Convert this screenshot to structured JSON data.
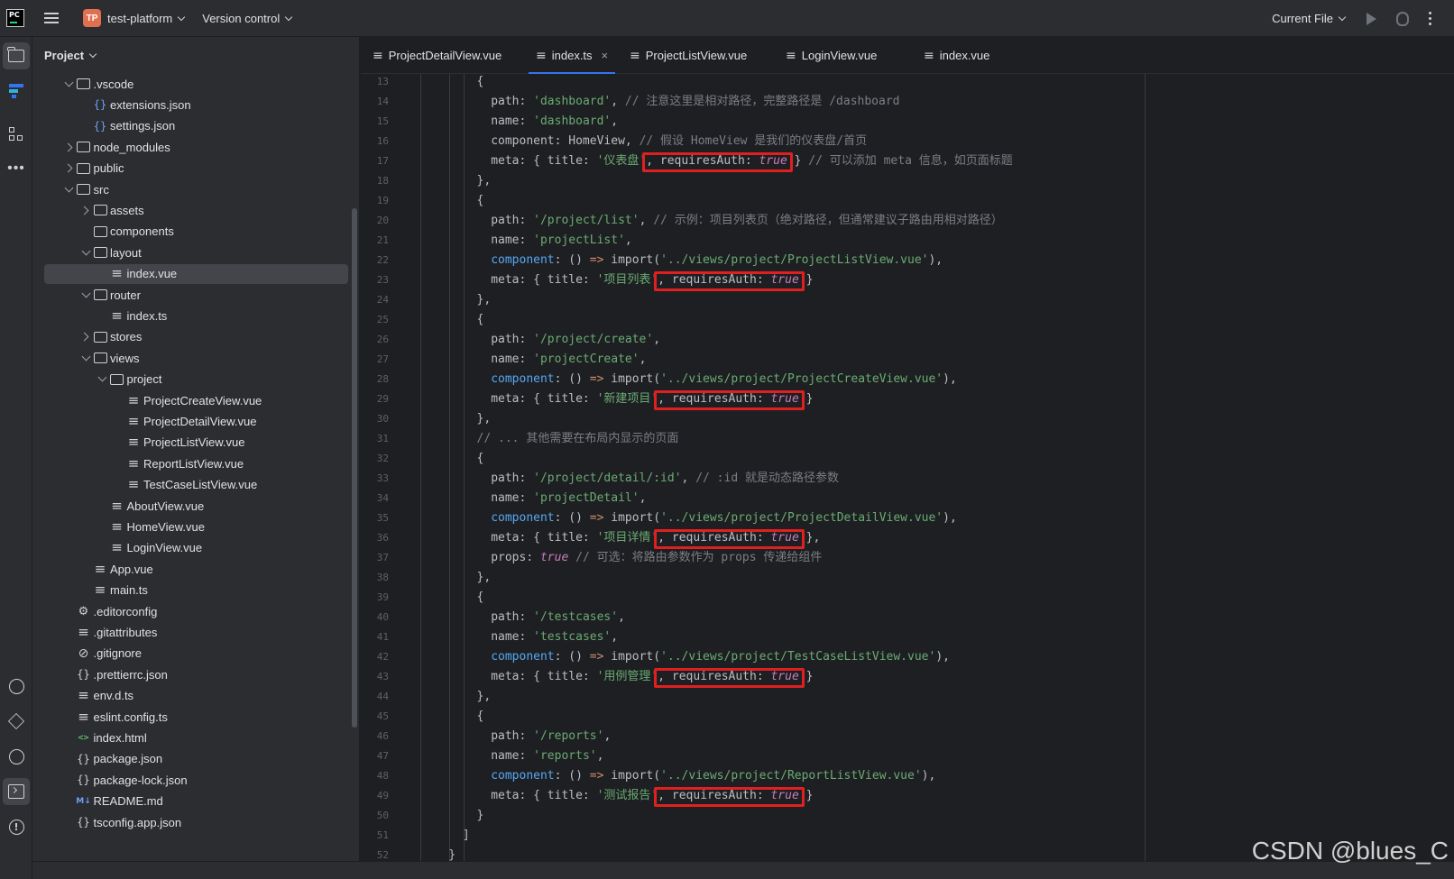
{
  "titlebar": {
    "project_badge": "TP",
    "project_name": "test-platform",
    "vcs": "Version control",
    "run_config": "Current File"
  },
  "project_panel": {
    "title": "Project",
    "tree": [
      {
        "label": ".vscode",
        "depth": 2,
        "arrow": "open",
        "icon": "folder"
      },
      {
        "label": "extensions.json",
        "depth": 3,
        "arrow": "none",
        "icon": "json-blue"
      },
      {
        "label": "settings.json",
        "depth": 3,
        "arrow": "none",
        "icon": "json-blue"
      },
      {
        "label": "node_modules",
        "depth": 2,
        "arrow": "closed",
        "icon": "folder"
      },
      {
        "label": "public",
        "depth": 2,
        "arrow": "closed",
        "icon": "folder"
      },
      {
        "label": "src",
        "depth": 2,
        "arrow": "open",
        "icon": "folder"
      },
      {
        "label": "assets",
        "depth": 3,
        "arrow": "closed",
        "icon": "folder"
      },
      {
        "label": "components",
        "depth": 3,
        "arrow": "none",
        "icon": "folder"
      },
      {
        "label": "layout",
        "depth": 3,
        "arrow": "open",
        "icon": "folder"
      },
      {
        "label": "index.vue",
        "depth": 4,
        "arrow": "none",
        "icon": "lines",
        "selected": true
      },
      {
        "label": "router",
        "depth": 3,
        "arrow": "open",
        "icon": "folder"
      },
      {
        "label": "index.ts",
        "depth": 4,
        "arrow": "none",
        "icon": "lines"
      },
      {
        "label": "stores",
        "depth": 3,
        "arrow": "closed",
        "icon": "folder"
      },
      {
        "label": "views",
        "depth": 3,
        "arrow": "open",
        "icon": "folder"
      },
      {
        "label": "project",
        "depth": 4,
        "arrow": "open",
        "icon": "folder"
      },
      {
        "label": "ProjectCreateView.vue",
        "depth": 5,
        "arrow": "none",
        "icon": "lines"
      },
      {
        "label": "ProjectDetailView.vue",
        "depth": 5,
        "arrow": "none",
        "icon": "lines"
      },
      {
        "label": "ProjectListView.vue",
        "depth": 5,
        "arrow": "none",
        "icon": "lines"
      },
      {
        "label": "ReportListView.vue",
        "depth": 5,
        "arrow": "none",
        "icon": "lines"
      },
      {
        "label": "TestCaseListView.vue",
        "depth": 5,
        "arrow": "none",
        "icon": "lines"
      },
      {
        "label": "AboutView.vue",
        "depth": 4,
        "arrow": "none",
        "icon": "lines"
      },
      {
        "label": "HomeView.vue",
        "depth": 4,
        "arrow": "none",
        "icon": "lines"
      },
      {
        "label": "LoginView.vue",
        "depth": 4,
        "arrow": "none",
        "icon": "lines"
      },
      {
        "label": "App.vue",
        "depth": 3,
        "arrow": "none",
        "icon": "lines"
      },
      {
        "label": "main.ts",
        "depth": 3,
        "arrow": "none",
        "icon": "lines"
      },
      {
        "label": ".editorconfig",
        "depth": 2,
        "arrow": "none",
        "icon": "gear"
      },
      {
        "label": ".gitattributes",
        "depth": 2,
        "arrow": "none",
        "icon": "lines"
      },
      {
        "label": ".gitignore",
        "depth": 2,
        "arrow": "none",
        "icon": "ban"
      },
      {
        "label": ".prettierrc.json",
        "depth": 2,
        "arrow": "none",
        "icon": "json"
      },
      {
        "label": "env.d.ts",
        "depth": 2,
        "arrow": "none",
        "icon": "lines"
      },
      {
        "label": "eslint.config.ts",
        "depth": 2,
        "arrow": "none",
        "icon": "lines"
      },
      {
        "label": "index.html",
        "depth": 2,
        "arrow": "none",
        "icon": "html"
      },
      {
        "label": "package.json",
        "depth": 2,
        "arrow": "none",
        "icon": "json"
      },
      {
        "label": "package-lock.json",
        "depth": 2,
        "arrow": "none",
        "icon": "json"
      },
      {
        "label": "README.md",
        "depth": 2,
        "arrow": "none",
        "icon": "md"
      },
      {
        "label": "tsconfig.app.json",
        "depth": 2,
        "arrow": "none",
        "icon": "json"
      }
    ]
  },
  "tabs": [
    {
      "label": "ProjectDetailView.vue",
      "active": false
    },
    {
      "label": "index.ts",
      "active": true,
      "closable": true
    },
    {
      "label": "ProjectListView.vue",
      "active": false
    },
    {
      "label": "LoginView.vue",
      "active": false
    },
    {
      "label": "index.vue",
      "active": false
    }
  ],
  "tab_close": "×",
  "editor": {
    "first_line": 13,
    "lines": [
      {
        "n": 13,
        "ind": 8,
        "parts": [
          [
            "k",
            "{"
          ]
        ]
      },
      {
        "n": 14,
        "ind": 10,
        "parts": [
          [
            "k",
            "path: "
          ],
          [
            "s",
            "'dashboard'"
          ],
          [
            "k",
            ", "
          ],
          [
            "c",
            "// 注意这里是相对路径，完整路径是 /dashboard"
          ]
        ]
      },
      {
        "n": 15,
        "ind": 10,
        "parts": [
          [
            "k",
            "name: "
          ],
          [
            "s",
            "'dashboard'"
          ],
          [
            "k",
            ","
          ]
        ]
      },
      {
        "n": 16,
        "ind": 10,
        "parts": [
          [
            "k",
            "component: HomeView, "
          ],
          [
            "c",
            "// 假设 HomeView 是我们的仪表盘/首页"
          ]
        ]
      },
      {
        "n": 17,
        "ind": 10,
        "parts": [
          [
            "k",
            "meta: { title: "
          ],
          [
            "s",
            "'仪表盘'"
          ],
          [
            "k",
            ", requiresAuth: "
          ],
          [
            "it",
            "true"
          ],
          [
            "k",
            " } "
          ],
          [
            "c",
            "// 可以添加 meta 信息，如页面标题"
          ]
        ]
      },
      {
        "n": 18,
        "ind": 8,
        "parts": [
          [
            "k",
            "},"
          ]
        ]
      },
      {
        "n": 19,
        "ind": 8,
        "parts": [
          [
            "k",
            "{"
          ]
        ]
      },
      {
        "n": 20,
        "ind": 10,
        "parts": [
          [
            "k",
            "path: "
          ],
          [
            "s",
            "'/project/list'"
          ],
          [
            "k",
            ", "
          ],
          [
            "c",
            "// 示例：项目列表页（绝对路径，但通常建议子路由用相对路径）"
          ]
        ]
      },
      {
        "n": 21,
        "ind": 10,
        "parts": [
          [
            "k",
            "name: "
          ],
          [
            "s",
            "'projectList'"
          ],
          [
            "k",
            ","
          ]
        ]
      },
      {
        "n": 22,
        "ind": 10,
        "parts": [
          [
            "f",
            "component"
          ],
          [
            "k",
            ": () "
          ],
          [
            "kw",
            "=>"
          ],
          [
            "k",
            " import("
          ],
          [
            "s",
            "'../views/project/ProjectListView.vue'"
          ],
          [
            "k",
            "),"
          ]
        ]
      },
      {
        "n": 23,
        "ind": 10,
        "parts": [
          [
            "k",
            "meta: { title: "
          ],
          [
            "s",
            "'项目列表'"
          ],
          [
            "k",
            ", requiresAuth: "
          ],
          [
            "it",
            "true"
          ],
          [
            "k",
            " }"
          ]
        ]
      },
      {
        "n": 24,
        "ind": 8,
        "parts": [
          [
            "k",
            "},"
          ]
        ]
      },
      {
        "n": 25,
        "ind": 8,
        "parts": [
          [
            "k",
            "{"
          ]
        ]
      },
      {
        "n": 26,
        "ind": 10,
        "parts": [
          [
            "k",
            "path: "
          ],
          [
            "s",
            "'/project/create'"
          ],
          [
            "k",
            ","
          ]
        ]
      },
      {
        "n": 27,
        "ind": 10,
        "parts": [
          [
            "k",
            "name: "
          ],
          [
            "s",
            "'projectCreate'"
          ],
          [
            "k",
            ","
          ]
        ]
      },
      {
        "n": 28,
        "ind": 10,
        "parts": [
          [
            "f",
            "component"
          ],
          [
            "k",
            ": () "
          ],
          [
            "kw",
            "=>"
          ],
          [
            "k",
            " import("
          ],
          [
            "s",
            "'../views/project/ProjectCreateView.vue'"
          ],
          [
            "k",
            "),"
          ]
        ]
      },
      {
        "n": 29,
        "ind": 10,
        "parts": [
          [
            "k",
            "meta: { title: "
          ],
          [
            "s",
            "'新建项目'"
          ],
          [
            "k",
            ", requiresAuth: "
          ],
          [
            "it",
            "true"
          ],
          [
            "k",
            " }"
          ]
        ]
      },
      {
        "n": 30,
        "ind": 8,
        "parts": [
          [
            "k",
            "},"
          ]
        ]
      },
      {
        "n": 31,
        "ind": 8,
        "parts": [
          [
            "c",
            "// ... 其他需要在布局内显示的页面"
          ]
        ]
      },
      {
        "n": 32,
        "ind": 8,
        "parts": [
          [
            "k",
            "{"
          ]
        ]
      },
      {
        "n": 33,
        "ind": 10,
        "parts": [
          [
            "k",
            "path: "
          ],
          [
            "s",
            "'/project/detail/:id'"
          ],
          [
            "k",
            ", "
          ],
          [
            "c",
            "// :id 就是动态路径参数"
          ]
        ]
      },
      {
        "n": 34,
        "ind": 10,
        "parts": [
          [
            "k",
            "name: "
          ],
          [
            "s",
            "'projectDetail'"
          ],
          [
            "k",
            ","
          ]
        ]
      },
      {
        "n": 35,
        "ind": 10,
        "parts": [
          [
            "f",
            "component"
          ],
          [
            "k",
            ": () "
          ],
          [
            "kw",
            "=>"
          ],
          [
            "k",
            " import("
          ],
          [
            "s",
            "'../views/project/ProjectDetailView.vue'"
          ],
          [
            "k",
            "),"
          ]
        ]
      },
      {
        "n": 36,
        "ind": 10,
        "parts": [
          [
            "k",
            "meta: { title: "
          ],
          [
            "s",
            "'项目详情'"
          ],
          [
            "k",
            ", requiresAuth: "
          ],
          [
            "it",
            "true"
          ],
          [
            "k",
            " },"
          ]
        ]
      },
      {
        "n": 37,
        "ind": 10,
        "parts": [
          [
            "k",
            "props: "
          ],
          [
            "it",
            "true"
          ],
          [
            "k",
            " "
          ],
          [
            "c",
            "// 可选：将路由参数作为 props 传递给组件"
          ]
        ]
      },
      {
        "n": 38,
        "ind": 8,
        "parts": [
          [
            "k",
            "},"
          ]
        ]
      },
      {
        "n": 39,
        "ind": 8,
        "parts": [
          [
            "k",
            "{"
          ]
        ]
      },
      {
        "n": 40,
        "ind": 10,
        "parts": [
          [
            "k",
            "path: "
          ],
          [
            "s",
            "'/testcases'"
          ],
          [
            "k",
            ","
          ]
        ]
      },
      {
        "n": 41,
        "ind": 10,
        "parts": [
          [
            "k",
            "name: "
          ],
          [
            "s",
            "'testcases'"
          ],
          [
            "k",
            ","
          ]
        ]
      },
      {
        "n": 42,
        "ind": 10,
        "parts": [
          [
            "f",
            "component"
          ],
          [
            "k",
            ": () "
          ],
          [
            "kw",
            "=>"
          ],
          [
            "k",
            " import("
          ],
          [
            "s",
            "'../views/project/TestCaseListView.vue'"
          ],
          [
            "k",
            "),"
          ]
        ]
      },
      {
        "n": 43,
        "ind": 10,
        "parts": [
          [
            "k",
            "meta: { title: "
          ],
          [
            "s",
            "'用例管理'"
          ],
          [
            "k",
            ", requiresAuth: "
          ],
          [
            "it",
            "true"
          ],
          [
            "k",
            " }"
          ]
        ]
      },
      {
        "n": 44,
        "ind": 8,
        "parts": [
          [
            "k",
            "},"
          ]
        ]
      },
      {
        "n": 45,
        "ind": 8,
        "parts": [
          [
            "k",
            "{"
          ]
        ]
      },
      {
        "n": 46,
        "ind": 10,
        "parts": [
          [
            "k",
            "path: "
          ],
          [
            "s",
            "'/reports'"
          ],
          [
            "k",
            ","
          ]
        ]
      },
      {
        "n": 47,
        "ind": 10,
        "parts": [
          [
            "k",
            "name: "
          ],
          [
            "s",
            "'reports'"
          ],
          [
            "k",
            ","
          ]
        ]
      },
      {
        "n": 48,
        "ind": 10,
        "parts": [
          [
            "f",
            "component"
          ],
          [
            "k",
            ": () "
          ],
          [
            "kw",
            "=>"
          ],
          [
            "k",
            " import("
          ],
          [
            "s",
            "'../views/project/ReportListView.vue'"
          ],
          [
            "k",
            "),"
          ]
        ]
      },
      {
        "n": 49,
        "ind": 10,
        "parts": [
          [
            "k",
            "meta: { title: "
          ],
          [
            "s",
            "'测试报告'"
          ],
          [
            "k",
            ", requiresAuth: "
          ],
          [
            "it",
            "true"
          ],
          [
            "k",
            " }"
          ]
        ]
      },
      {
        "n": 50,
        "ind": 8,
        "parts": [
          [
            "k",
            "}"
          ]
        ]
      },
      {
        "n": 51,
        "ind": 6,
        "parts": [
          [
            "k",
            "]"
          ]
        ]
      },
      {
        "n": 52,
        "ind": 4,
        "parts": [
          [
            "k",
            "}"
          ]
        ]
      }
    ],
    "highlight_line_numbers": [
      17,
      23,
      29,
      36,
      43,
      49
    ]
  },
  "watermark": "CSDN @blues_C",
  "colors": {
    "accent": "#3574f0",
    "highlight_box": "#e02020",
    "string": "#6aab73",
    "comment": "#7a7e85",
    "keyword_true": "#c77dbb"
  }
}
